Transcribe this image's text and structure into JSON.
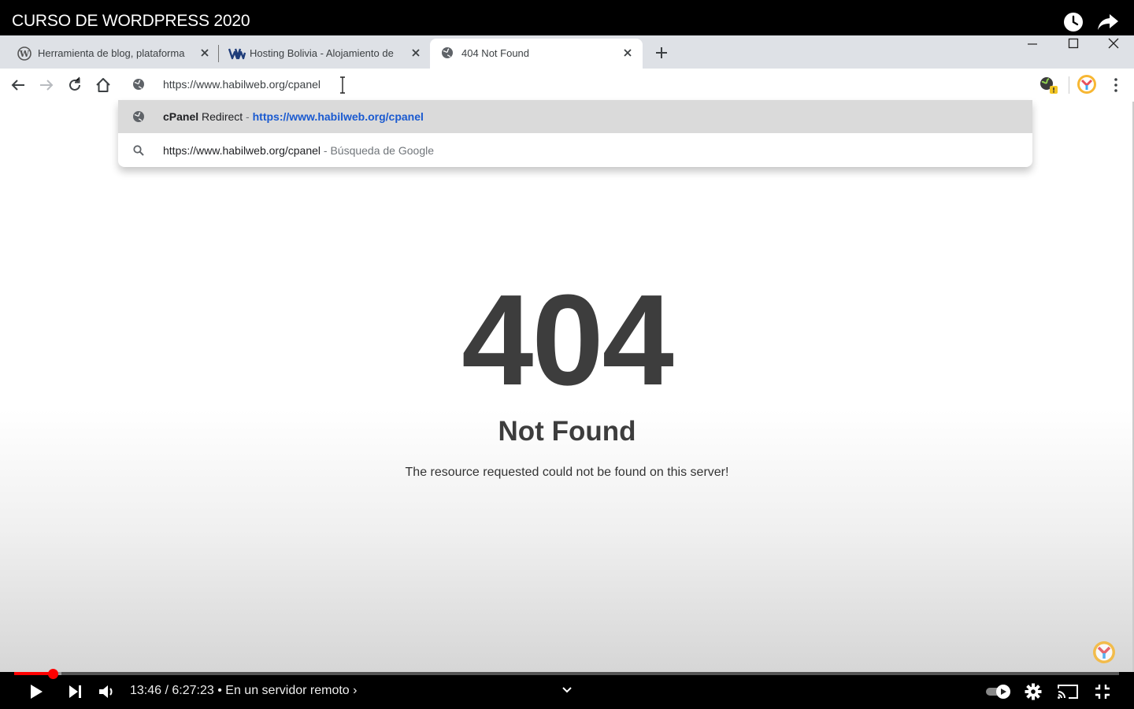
{
  "youtube": {
    "video_title": "CURSO DE WORDPRESS 2020",
    "time_current": "13:46",
    "time_total": "6:27:23",
    "chapter": "En un servidor remoto",
    "progress_percent": 3.5
  },
  "browser": {
    "tabs": [
      {
        "title": "Herramienta de blog, plataforma",
        "icon": "wordpress-icon",
        "active": false
      },
      {
        "title": "Hosting Bolivia - Alojamiento de",
        "icon": "habilweb-icon",
        "active": false
      },
      {
        "title": "404 Not Found",
        "icon": "globe-icon",
        "active": true
      }
    ],
    "address": "https://www.habilweb.org/cpanel",
    "suggestions": [
      {
        "title": "cPanel",
        "title_rest": " Redirect",
        "separator": " - ",
        "url": "https://www.habilweb.org/cpanel",
        "icon": "globe-icon",
        "highlighted": true
      },
      {
        "query": "https://www.habilweb.org/cpanel",
        "separator": " - ",
        "engine": "Búsqueda de Google",
        "icon": "search-icon",
        "highlighted": false
      }
    ]
  },
  "page": {
    "code": "404",
    "title": "Not Found",
    "message": "The resource requested could not be found on this server!"
  },
  "colors": {
    "accent_red": "#ff0000",
    "error_text": "#3d3d3d",
    "suggestion_link": "#1a5ad0"
  }
}
